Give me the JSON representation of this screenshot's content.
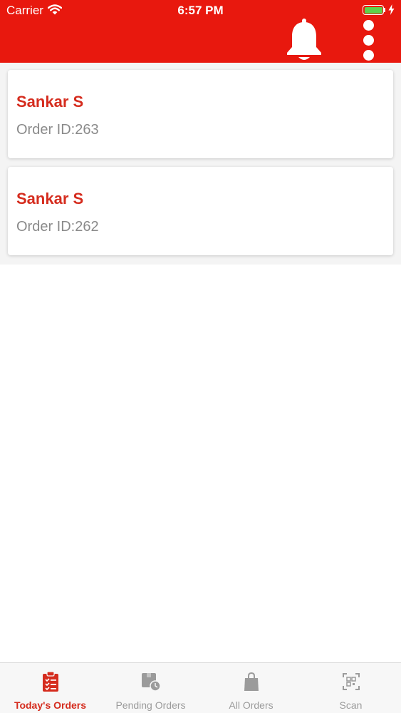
{
  "status_bar": {
    "carrier": "Carrier",
    "time": "6:57 PM",
    "battery_color": "#5ED24B"
  },
  "header": {
    "background_color": "#E8180E",
    "icons": [
      "bell-icon",
      "more-vertical-icon"
    ]
  },
  "orders": [
    {
      "name": "Sankar S",
      "order_id": "Order ID:263"
    },
    {
      "name": "Sankar S",
      "order_id": "Order ID:262"
    }
  ],
  "tabs": [
    {
      "label": "Today's Orders",
      "icon": "clipboard-checklist-icon",
      "active": true
    },
    {
      "label": "Pending Orders",
      "icon": "box-clock-icon",
      "active": false
    },
    {
      "label": "All Orders",
      "icon": "shopping-bag-icon",
      "active": false
    },
    {
      "label": "Scan",
      "icon": "qr-scan-icon",
      "active": false
    }
  ],
  "colors": {
    "accent": "#D52C1E",
    "inactive": "#9B9B9B",
    "secondary_text": "#8A8A8A"
  }
}
